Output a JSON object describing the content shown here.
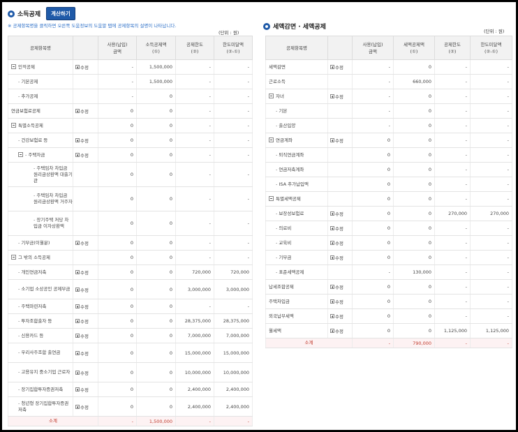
{
  "left": {
    "title": "소득공제",
    "calc_button": "계산하기",
    "notice": "※ 공제항목명을 클릭하면 오른쪽 도움정보의 도움말 탭에 공제항목의 설명이 나타납니다.",
    "unit": "(단위 : 원)",
    "headers": [
      "공제항목명",
      "",
      "사용(납입)\n금액",
      "소득공제액\n(①)",
      "공제한도\n(②)",
      "한도미달액\n(②-①)"
    ],
    "rows": [
      {
        "name": "인적공제",
        "level": 0,
        "toggle": true,
        "edit": "수정",
        "used": "-",
        "deduct": "1,500,000",
        "limit": "-",
        "short": "-"
      },
      {
        "name": "기본공제",
        "level": 1,
        "edit": "",
        "used": "-",
        "deduct": "1,500,000",
        "limit": "-",
        "short": "-"
      },
      {
        "name": "추가공제",
        "level": 1,
        "edit": "",
        "used": "-",
        "deduct": "0",
        "limit": "-",
        "short": "-"
      },
      {
        "name": "연금보험료공제",
        "level": 0,
        "edit": "수정",
        "used": "0",
        "deduct": "0",
        "limit": "-",
        "short": "-"
      },
      {
        "name": "특별소득공제",
        "level": 0,
        "toggle": true,
        "edit": "",
        "used": "0",
        "deduct": "0",
        "limit": "-",
        "short": "-"
      },
      {
        "name": "건강보험료 등",
        "level": 1,
        "edit": "수정",
        "used": "0",
        "deduct": "0",
        "limit": "-",
        "short": "-"
      },
      {
        "name": "주택자금",
        "level": 1,
        "toggle": true,
        "edit": "수정",
        "used": "0",
        "deduct": "0",
        "limit": "-",
        "short": "-"
      },
      {
        "name": "주택임차 차입금 원리금상환액 대출기관",
        "level": 2,
        "edit": "",
        "used": "0",
        "deduct": "0",
        "limit": "-",
        "short": "-"
      },
      {
        "name": "주택임차 차입금 원리금상환액 거주자",
        "level": 2,
        "edit": "",
        "used": "0",
        "deduct": "0",
        "limit": "-",
        "short": "-"
      },
      {
        "name": "장기주택 저당 차입금 이자상환액",
        "level": 2,
        "edit": "",
        "used": "0",
        "deduct": "0",
        "limit": "-",
        "short": "-"
      },
      {
        "name": "기부금(이월분)",
        "level": 1,
        "edit": "수정",
        "used": "0",
        "deduct": "0",
        "limit": "-",
        "short": "-"
      },
      {
        "name": "그 밖의 소득공제",
        "level": 0,
        "toggle": true,
        "edit": "",
        "used": "0",
        "deduct": "0",
        "limit": "-",
        "short": "-"
      },
      {
        "name": "개인연금저축",
        "level": 1,
        "edit": "수정",
        "used": "0",
        "deduct": "0",
        "limit": "720,000",
        "short": "720,000"
      },
      {
        "name": "소기업 소상공인 공제부금",
        "level": 1,
        "edit": "수정",
        "used": "0",
        "deduct": "0",
        "limit": "3,000,000",
        "short": "3,000,000"
      },
      {
        "name": "주택마련저축",
        "level": 1,
        "edit": "수정",
        "used": "0",
        "deduct": "0",
        "limit": "-",
        "short": "-"
      },
      {
        "name": "투자조합출자 등",
        "level": 1,
        "edit": "수정",
        "used": "0",
        "deduct": "0",
        "limit": "28,375,000",
        "short": "28,375,000"
      },
      {
        "name": "신용카드 등",
        "level": 1,
        "edit": "수정",
        "used": "0",
        "deduct": "0",
        "limit": "7,000,000",
        "short": "7,000,000"
      },
      {
        "name": "우리사주조합 출연금",
        "level": 1,
        "edit": "수정",
        "used": "0",
        "deduct": "0",
        "limit": "15,000,000",
        "short": "15,000,000"
      },
      {
        "name": "고용유지 중소기업 근로자",
        "level": 1,
        "edit": "수정",
        "used": "0",
        "deduct": "0",
        "limit": "10,000,000",
        "short": "10,000,000"
      },
      {
        "name": "장기집합투자증권저축",
        "level": 1,
        "edit": "수정",
        "used": "0",
        "deduct": "0",
        "limit": "2,400,000",
        "short": "2,400,000"
      },
      {
        "name": "청년형 장기집합투자증권저축",
        "level": 1,
        "edit": "수정",
        "used": "0",
        "deduct": "0",
        "limit": "2,400,000",
        "short": "2,400,000"
      }
    ],
    "total": {
      "name": "소계",
      "used": "-",
      "deduct": "1,500,000",
      "limit": "-",
      "short": "-"
    }
  },
  "right": {
    "title": "세액감면 · 세액공제",
    "unit": "(단위 : 원)",
    "headers": [
      "공제항목명",
      "",
      "사용(납입)\n금액",
      "세액공제액\n(①)",
      "공제한도\n(②)",
      "한도미달액\n(②-①)"
    ],
    "rows": [
      {
        "name": "세액감면",
        "level": 0,
        "edit": "수정",
        "used": "-",
        "deduct": "0",
        "limit": "-",
        "short": "-"
      },
      {
        "name": "근로소득",
        "level": 0,
        "edit": "",
        "used": "-",
        "deduct": "660,000",
        "limit": "-",
        "short": "-"
      },
      {
        "name": "자녀",
        "level": 0,
        "toggle": true,
        "edit": "수정",
        "used": "-",
        "deduct": "0",
        "limit": "-",
        "short": "-"
      },
      {
        "name": "기본",
        "level": 1,
        "edit": "",
        "used": "-",
        "deduct": "0",
        "limit": "-",
        "short": "-"
      },
      {
        "name": "출산입양",
        "level": 1,
        "edit": "",
        "used": "-",
        "deduct": "0",
        "limit": "-",
        "short": "-"
      },
      {
        "name": "연금계좌",
        "level": 0,
        "toggle": true,
        "edit": "수정",
        "used": "0",
        "deduct": "0",
        "limit": "-",
        "short": "-"
      },
      {
        "name": "퇴직연금계좌",
        "level": 1,
        "edit": "",
        "used": "0",
        "deduct": "0",
        "limit": "-",
        "short": "-"
      },
      {
        "name": "연금저축계좌",
        "level": 1,
        "edit": "",
        "used": "0",
        "deduct": "0",
        "limit": "-",
        "short": "-"
      },
      {
        "name": "ISA 추가납입액",
        "level": 1,
        "edit": "",
        "used": "0",
        "deduct": "0",
        "limit": "-",
        "short": "-"
      },
      {
        "name": "특별세액공제",
        "level": 0,
        "toggle": true,
        "edit": "",
        "used": "0",
        "deduct": "0",
        "limit": "-",
        "short": "-"
      },
      {
        "name": "보장성보험료",
        "level": 1,
        "edit": "수정",
        "used": "0",
        "deduct": "0",
        "limit": "270,000",
        "short": "270,000"
      },
      {
        "name": "의료비",
        "level": 1,
        "edit": "수정",
        "used": "0",
        "deduct": "0",
        "limit": "-",
        "short": "-"
      },
      {
        "name": "교육비",
        "level": 1,
        "edit": "수정",
        "used": "0",
        "deduct": "0",
        "limit": "-",
        "short": "-"
      },
      {
        "name": "기부금",
        "level": 1,
        "edit": "수정",
        "used": "0",
        "deduct": "0",
        "limit": "-",
        "short": "-"
      },
      {
        "name": "표준세액공제",
        "level": 1,
        "edit": "",
        "used": "-",
        "deduct": "130,000",
        "limit": "-",
        "short": "-"
      },
      {
        "name": "납세조합공제",
        "level": 0,
        "edit": "수정",
        "used": "0",
        "deduct": "0",
        "limit": "-",
        "short": "-"
      },
      {
        "name": "주택차입금",
        "level": 0,
        "edit": "수정",
        "used": "0",
        "deduct": "0",
        "limit": "-",
        "short": "-"
      },
      {
        "name": "외국납부세액",
        "level": 0,
        "edit": "수정",
        "used": "0",
        "deduct": "0",
        "limit": "-",
        "short": "-"
      },
      {
        "name": "월세액",
        "level": 0,
        "edit": "수정",
        "used": "0",
        "deduct": "0",
        "limit": "1,125,000",
        "short": "1,125,000"
      }
    ],
    "total": {
      "name": "소계",
      "used": "-",
      "deduct": "790,000",
      "limit": "-",
      "short": "-"
    }
  }
}
